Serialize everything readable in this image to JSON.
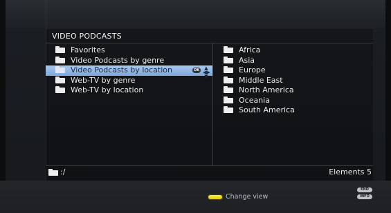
{
  "header": {
    "title": "VIDEO PODCASTS"
  },
  "left_list": {
    "items": [
      {
        "label": "Favorites",
        "selected": false
      },
      {
        "label": "Video Podcasts by genre",
        "selected": false
      },
      {
        "label": "Video Podcasts by location",
        "selected": true
      },
      {
        "label": "Web-TV by genre",
        "selected": false
      },
      {
        "label": "Web-TV by location",
        "selected": false
      }
    ],
    "selected_badges": {
      "ok": "OK"
    }
  },
  "right_list": {
    "items": [
      {
        "label": "Africa"
      },
      {
        "label": "Asia"
      },
      {
        "label": "Europe"
      },
      {
        "label": "Middle East"
      },
      {
        "label": "North America"
      },
      {
        "label": "Oceania"
      },
      {
        "label": "South America"
      }
    ]
  },
  "status": {
    "path": ":/",
    "elements": "Elements 5"
  },
  "footer": {
    "change_view_label": "Change view",
    "end_label": "END",
    "info_label": "INFO",
    "yellow_color": "#f4e21a"
  },
  "colors": {
    "selection": "#9bbce6",
    "background": "#16181b"
  }
}
